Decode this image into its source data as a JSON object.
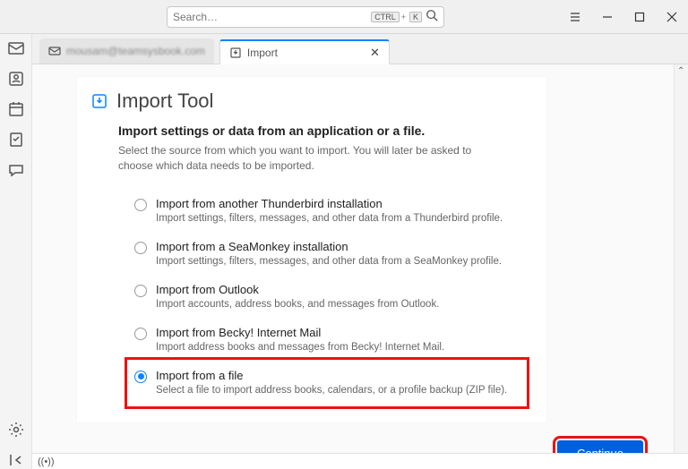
{
  "titlebar": {
    "search_placeholder": "Search…",
    "kbd_ctrl": "CTRL",
    "kbd_plus": "+",
    "kbd_k": "K"
  },
  "tabs": {
    "bg_label": "mousam@teamsysbook.com",
    "active_label": "Import"
  },
  "tool": {
    "title": "Import Tool",
    "subtitle": "Import settings or data from an application or a file.",
    "description": "Select the source from which you want to import. You will later be asked to choose which data needs to be imported."
  },
  "options": [
    {
      "label": "Import from another Thunderbird installation",
      "desc": "Import settings, filters, messages, and other data from a Thunderbird profile."
    },
    {
      "label": "Import from a SeaMonkey installation",
      "desc": "Import settings, filters, messages, and other data from a SeaMonkey profile."
    },
    {
      "label": "Import from Outlook",
      "desc": "Import accounts, address books, and messages from Outlook."
    },
    {
      "label": "Import from Becky! Internet Mail",
      "desc": "Import address books and messages from Becky! Internet Mail."
    },
    {
      "label": "Import from a file",
      "desc": "Select a file to import address books, calendars, or a profile backup (ZIP file)."
    }
  ],
  "buttons": {
    "continue": "Continue"
  },
  "status": {
    "signal": "((•))"
  }
}
